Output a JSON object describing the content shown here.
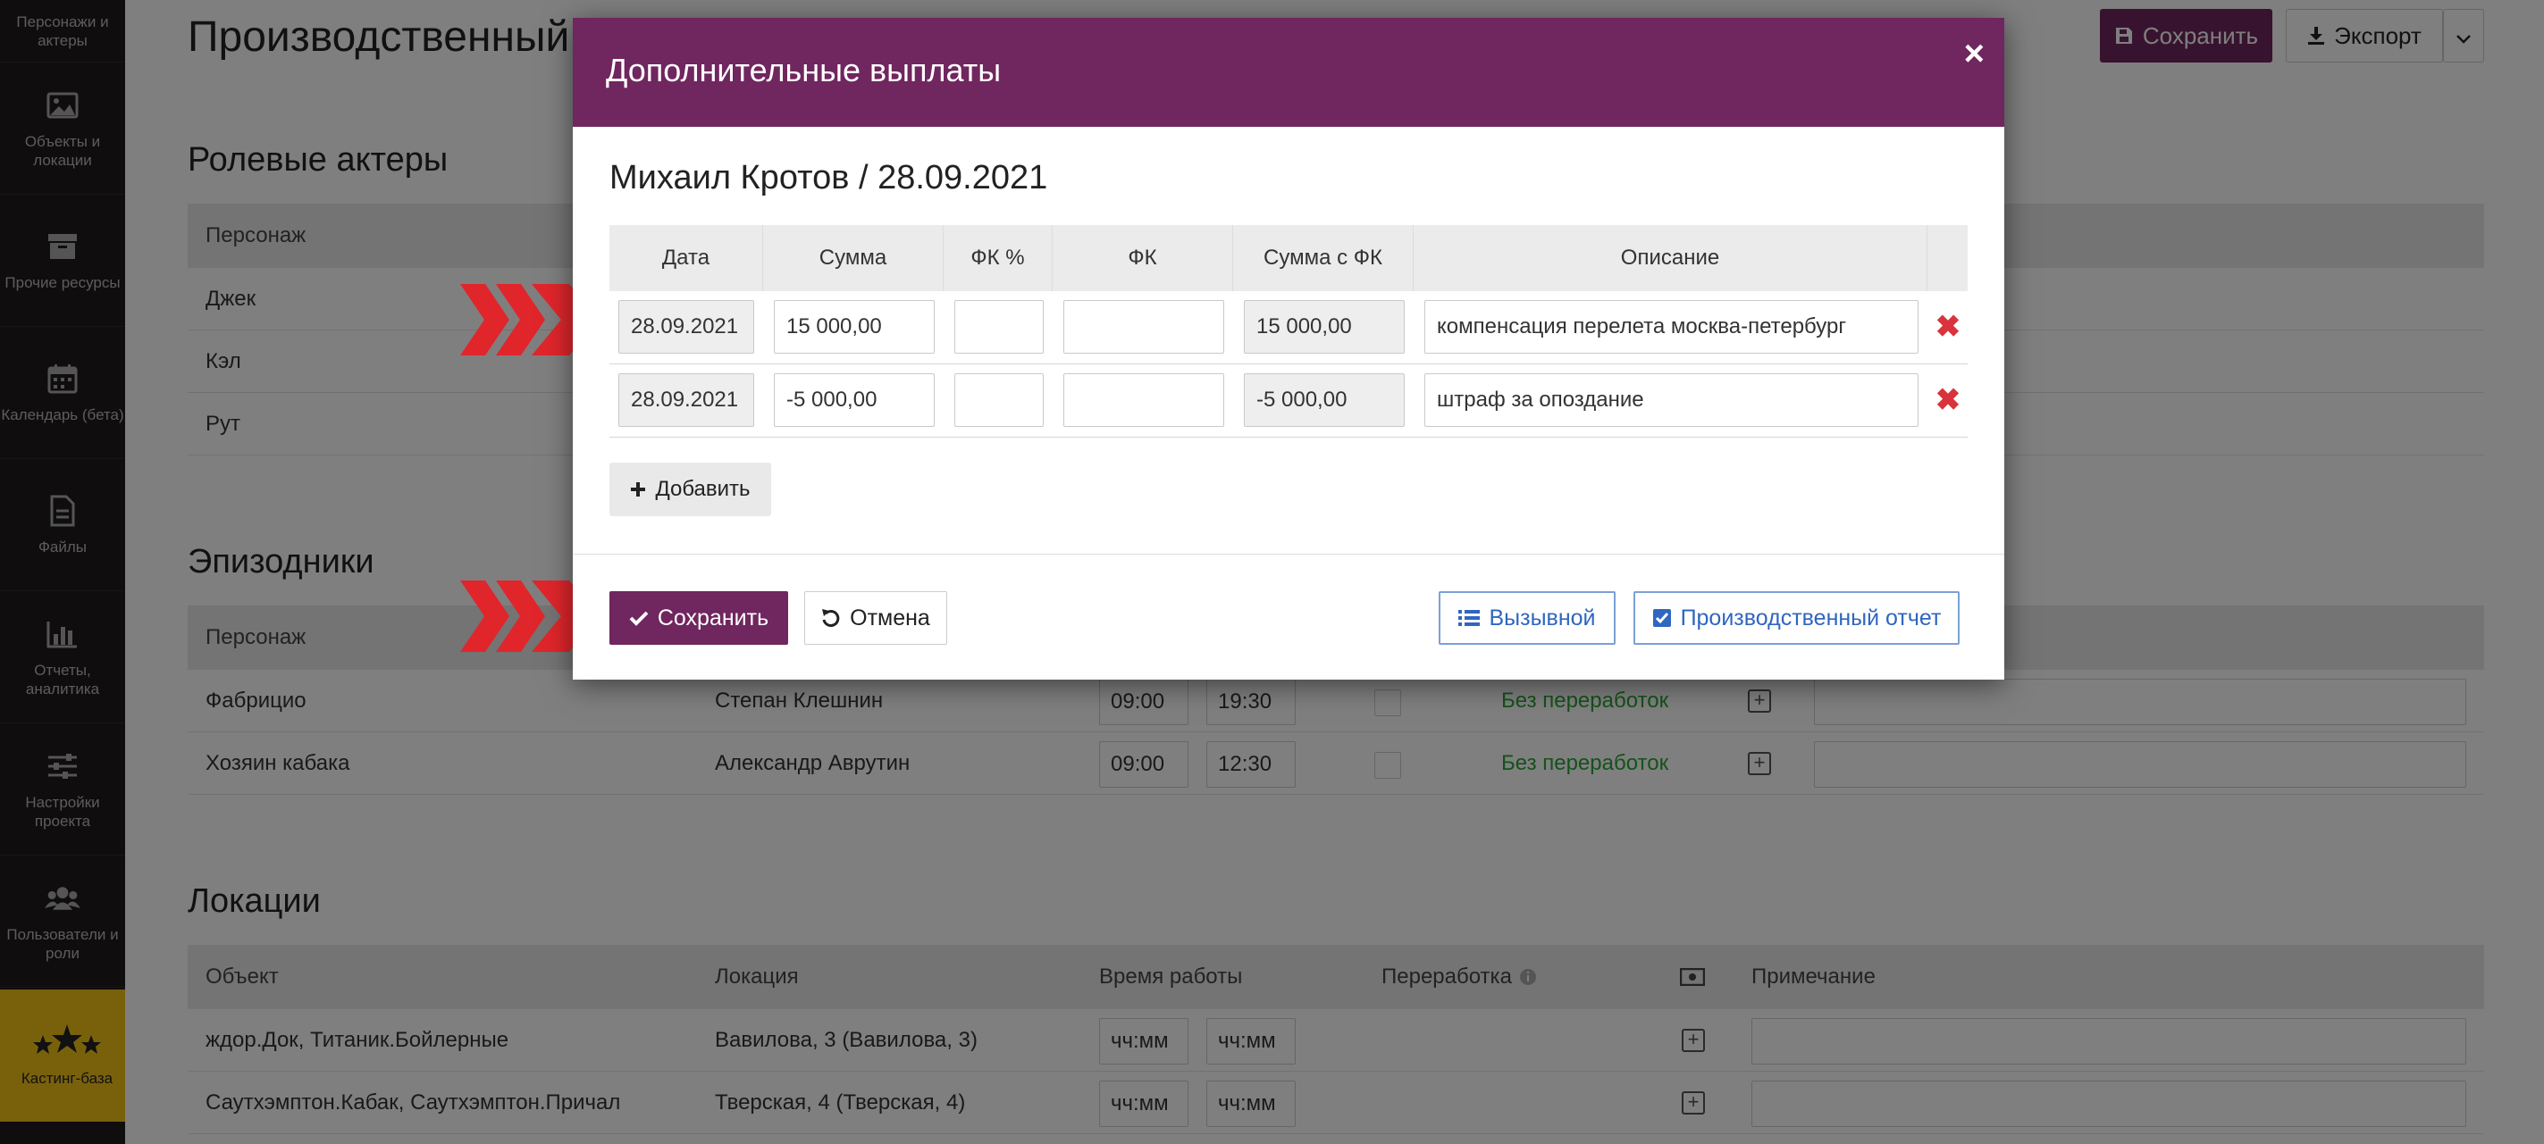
{
  "sidebar": {
    "items": [
      {
        "label": "Персонажи и актеры",
        "icon": "person-icon"
      },
      {
        "label": "Объекты и локации",
        "icon": "image-icon"
      },
      {
        "label": "Прочие ресурсы",
        "icon": "box-icon"
      },
      {
        "label": "Календарь (бета)",
        "icon": "calendar-icon"
      },
      {
        "label": "Файлы",
        "icon": "file-icon"
      },
      {
        "label": "Отчеты, аналитика",
        "icon": "bar-chart-icon"
      },
      {
        "label": "Настройки проекта",
        "icon": "sliders-icon"
      },
      {
        "label": "Пользователи и роли",
        "icon": "users-icon"
      },
      {
        "label": "Кастинг-база",
        "icon": "stars-icon"
      }
    ]
  },
  "page": {
    "title": "Производственный",
    "save_label": "Сохранить",
    "export_label": "Экспорт",
    "sections": {
      "roles": {
        "title": "Ролевые актеры",
        "header": "Персонаж",
        "rows": [
          "Джек",
          "Кэл",
          "Рут"
        ]
      },
      "episodic": {
        "title": "Эпизодники",
        "header": "Персонаж",
        "rows": [
          {
            "name": "Фабрицио",
            "actor": "Степан Клешнин",
            "from": "09:00",
            "to": "19:30",
            "status": "Без переработок"
          },
          {
            "name": "Хозяин кабака",
            "actor": "Александр Аврутин",
            "from": "09:00",
            "to": "12:30",
            "status": "Без переработок"
          }
        ]
      },
      "locations": {
        "title": "Локации",
        "headers": {
          "object": "Объект",
          "location": "Локация",
          "work_time": "Время работы",
          "overtime": "Переработка",
          "note": "Примечание"
        },
        "time_placeholder": "чч:мм",
        "rows": [
          {
            "object": "ждор.Док, Титаник.Бойлерные",
            "location": "Вавилова, 3 (Вавилова, 3)"
          },
          {
            "object": "Саутхэмптон.Кабак, Саутхэмптон.Причал",
            "location": "Тверская, 4 (Тверская, 4)"
          }
        ]
      }
    }
  },
  "modal": {
    "title": "Дополнительные выплаты",
    "close": "×",
    "subtitle": "Михаил Кротов / 28.09.2021",
    "columns": [
      "Дата",
      "Сумма",
      "ФК %",
      "ФК",
      "Сумма с ФК",
      "Описание"
    ],
    "rows": [
      {
        "date": "28.09.2021",
        "amount": "15 000,00",
        "fk_pct": "",
        "fk": "",
        "total": "15 000,00",
        "description": "компенсация перелета москва-петербург"
      },
      {
        "date": "28.09.2021",
        "amount": "-5 000,00",
        "fk_pct": "",
        "fk": "",
        "total": "-5 000,00",
        "description": "штраф за опоздание"
      }
    ],
    "add_label": "Добавить",
    "save_label": "Сохранить",
    "cancel_label": "Отмена",
    "call_label": "Вызывной",
    "report_label": "Производственный отчет"
  },
  "colors": {
    "brand": "#70265e",
    "sidebar": "#1e1a1d",
    "accent_yellow": "#f2c318",
    "link_blue": "#2f66c0",
    "delete_red": "#d9343b",
    "arrow_red": "#e0262b",
    "ok_green": "#2aa536"
  }
}
